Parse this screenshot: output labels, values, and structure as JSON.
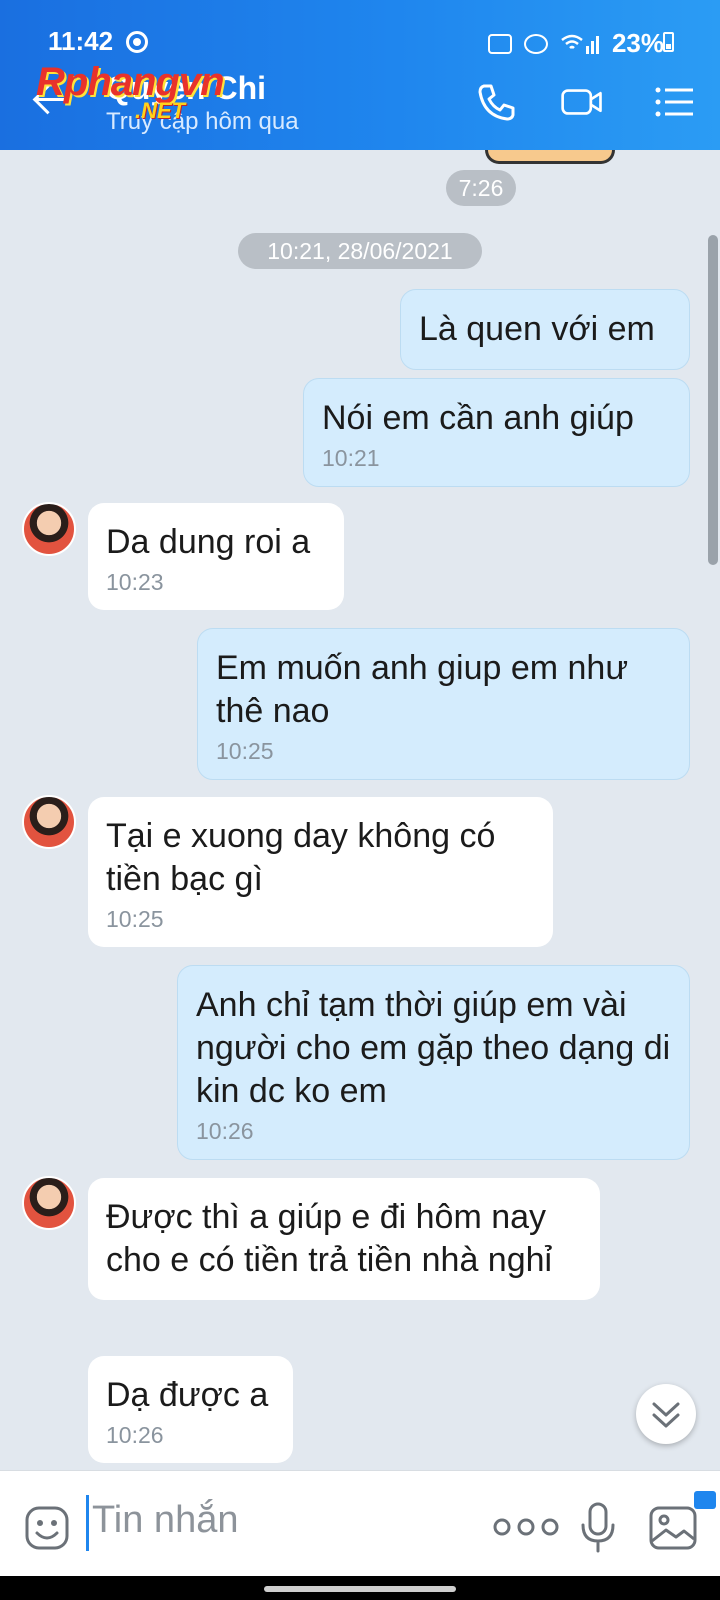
{
  "status_bar": {
    "time": "11:42",
    "battery": "23%"
  },
  "header": {
    "contact_name": "Quyen Chi",
    "contact_status": "Truy cập hôm qua",
    "watermark": "Rphangvn",
    "watermark_sub": ".NET"
  },
  "timeline": {
    "sticker_time": "7:26",
    "date_divider": "10:21, 28/06/2021"
  },
  "messages": [
    {
      "dir": "out",
      "text": "Là quen với em",
      "time": ""
    },
    {
      "dir": "out",
      "text": "Nói em cần anh giúp",
      "time": "10:21"
    },
    {
      "dir": "in",
      "text": "Da dung roi a",
      "time": "10:23"
    },
    {
      "dir": "out",
      "text": "Em muốn anh giup em như thê nao",
      "time": "10:25"
    },
    {
      "dir": "in",
      "text": "Tại e xuong day không có tiền bạc gì",
      "time": "10:25"
    },
    {
      "dir": "out",
      "text": "Anh chỉ tạm thời giúp em vài người cho em gặp theo dạng di kin dc ko em",
      "time": "10:26"
    },
    {
      "dir": "in",
      "text": "Được thì a giúp e đi hôm nay cho e có tiền trả tiền nhà nghỉ",
      "time": ""
    },
    {
      "dir": "in",
      "text": "Dạ được a",
      "time": "10:26"
    }
  ],
  "composer": {
    "placeholder": "Tin nhắn"
  },
  "colors": {
    "header_blue": "#1f86ee",
    "outgoing_bubble": "#d4ecfd",
    "incoming_bubble": "#ffffff",
    "background": "#e2e8ef"
  },
  "icons": [
    "back-arrow-icon",
    "phone-icon",
    "video-call-icon",
    "menu-list-icon",
    "emoji-icon",
    "more-icon",
    "microphone-icon",
    "gallery-icon",
    "scroll-down-icon"
  ]
}
